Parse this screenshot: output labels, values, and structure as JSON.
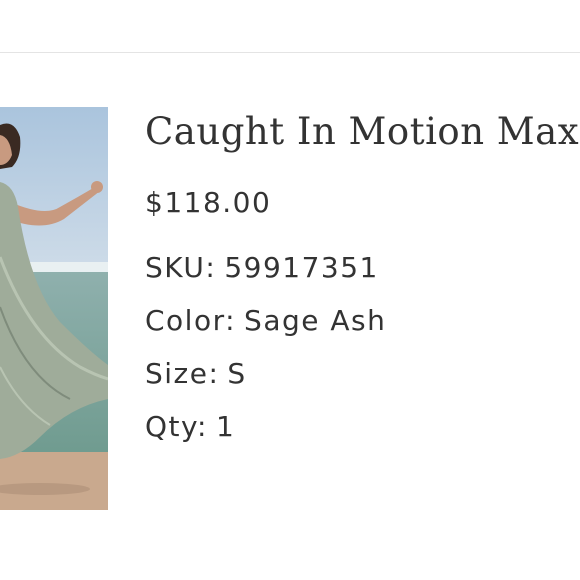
{
  "product": {
    "title": "Caught In Motion Max",
    "price": "$118.00",
    "sku_label": "SKU:",
    "sku_value": "59917351",
    "color_label": "Color:",
    "color_value": "Sage Ash",
    "size_label": "Size:",
    "size_value": "S",
    "qty_label": "Qty:",
    "qty_value": "1"
  },
  "colors": {
    "text": "#333333",
    "divider": "#e4e4e4",
    "dress": "#9fac9a",
    "sky": "#b9cfe2"
  }
}
